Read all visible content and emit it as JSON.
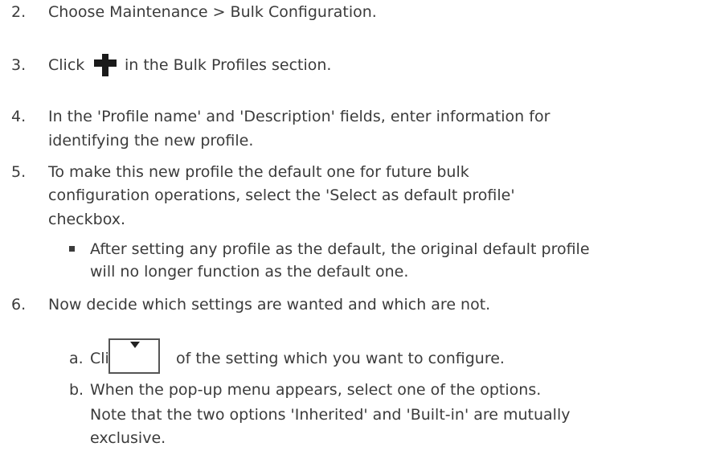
{
  "steps": {
    "s2": {
      "num": "2.",
      "text": "Choose Maintenance > Bulk Configuration."
    },
    "s3": {
      "num": "3.",
      "pre": "Click",
      "post": "in the Bulk Profiles section.",
      "icon": "plus-icon"
    },
    "s4": {
      "num": "4.",
      "line1": "In the 'Profile name' and 'Description' fields, enter information for",
      "line2": "identifying the new profile."
    },
    "s5": {
      "num": "5.",
      "line1": "To make this new profile the default one for future bulk",
      "line2": "configuration operations, select the 'Select as default profile'",
      "line3": "checkbox.",
      "bullet_line1": "After setting any profile as the default, the original default profile",
      "bullet_line2": "will no longer function as the default one."
    },
    "s6": {
      "num": "6.",
      "text": "Now decide which settings are wanted and which are not.",
      "a": {
        "label": "a.",
        "pre": "Click",
        "post": "of the setting which you want to configure.",
        "icon": "dropdown-icon"
      },
      "b": {
        "label": "b.",
        "text": "When the pop-up menu appears, select one of the options.",
        "note1": "Note that the two options 'Inherited' and 'Built-in' are mutually",
        "note2": "exclusive."
      }
    }
  }
}
